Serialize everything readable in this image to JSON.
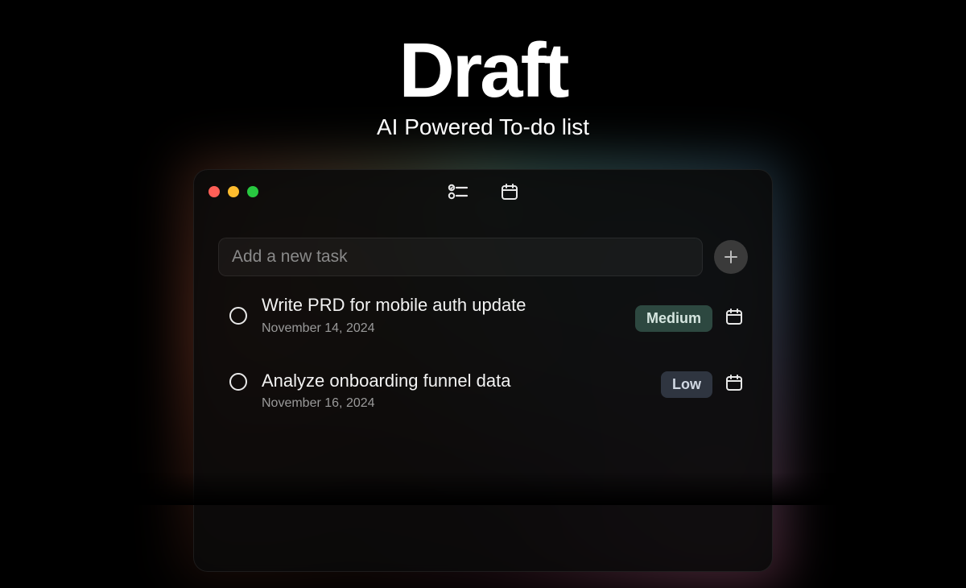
{
  "hero": {
    "title": "Draft",
    "subtitle": "AI Powered To-do list"
  },
  "input": {
    "placeholder": "Add a new task"
  },
  "tasks": [
    {
      "title": "Write PRD for mobile auth update",
      "date": "November 14, 2024",
      "priority": "Medium",
      "priority_class": "medium"
    },
    {
      "title": "Analyze onboarding funnel data",
      "date": "November 16, 2024",
      "priority": "Low",
      "priority_class": "low"
    }
  ]
}
